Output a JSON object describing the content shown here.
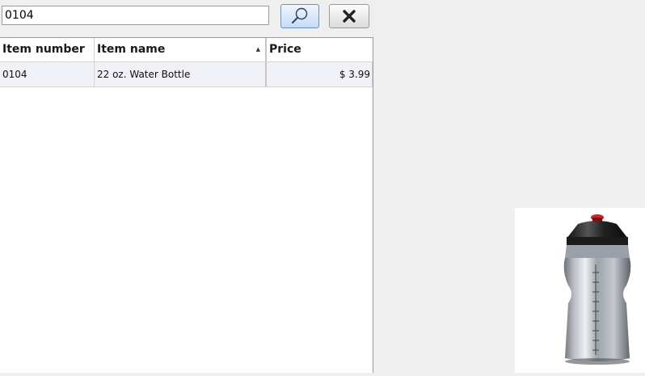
{
  "search": {
    "value": "0104"
  },
  "grid": {
    "columns": [
      "Item number",
      "Item name",
      "Price"
    ],
    "sorted_column": "Item name",
    "sort_direction": "ascending",
    "rows": [
      {
        "item_number": "0104",
        "item_name": "22 oz. Water Bottle",
        "price": "$ 3.99"
      }
    ]
  },
  "product_image": {
    "icon": "water-bottle-icon"
  }
}
